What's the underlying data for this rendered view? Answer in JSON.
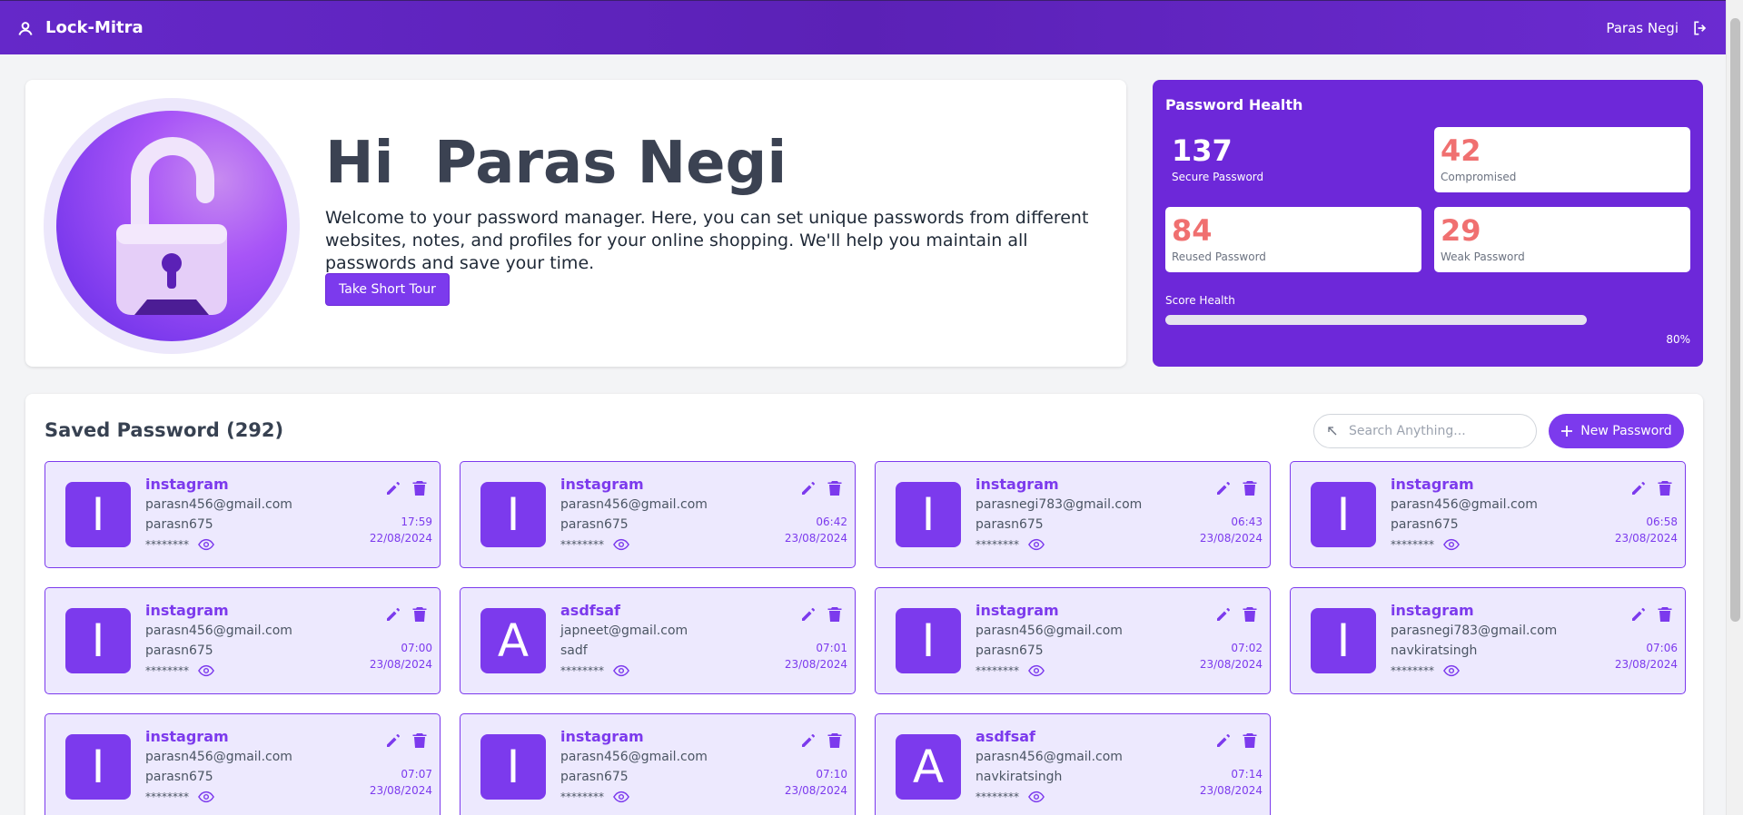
{
  "header": {
    "app_name": "Lock-Mitra",
    "user_name": "Paras Negi"
  },
  "welcome": {
    "greeting": "Hi  Paras Negi",
    "message": "Welcome to your password manager. Here, you can set unique passwords from different websites, notes, and profiles for your online shopping. We'll help you maintain all passwords and save your time.",
    "tour_button": "Take Short Tour"
  },
  "health": {
    "title": "Password Health",
    "secure": {
      "value": "137",
      "label": "Secure Password"
    },
    "compromised": {
      "value": "42",
      "label": "Compromised"
    },
    "reused": {
      "value": "84",
      "label": "Reused Password"
    },
    "weak": {
      "value": "29",
      "label": "Weak Password"
    },
    "score_label": "Score Health",
    "score_percent": "80%",
    "score_fraction": 0.8
  },
  "saved": {
    "title": "Saved Password (292)",
    "search_placeholder": "Search Anything...",
    "new_button": "New Password",
    "items": [
      {
        "letter": "I",
        "site": "instagram",
        "email": "parasn456@gmail.com",
        "username": "parasn675",
        "masked": "********",
        "time": "17:59",
        "date": "22/08/2024"
      },
      {
        "letter": "I",
        "site": "instagram",
        "email": "parasn456@gmail.com",
        "username": "parasn675",
        "masked": "********",
        "time": "06:42",
        "date": "23/08/2024"
      },
      {
        "letter": "I",
        "site": "instagram",
        "email": "parasnegi783@gmail.com",
        "username": "parasn675",
        "masked": "********",
        "time": "06:43",
        "date": "23/08/2024"
      },
      {
        "letter": "I",
        "site": "instagram",
        "email": "parasn456@gmail.com",
        "username": "parasn675",
        "masked": "********",
        "time": "06:58",
        "date": "23/08/2024"
      },
      {
        "letter": "I",
        "site": "instagram",
        "email": "parasn456@gmail.com",
        "username": "parasn675",
        "masked": "********",
        "time": "07:00",
        "date": "23/08/2024"
      },
      {
        "letter": "A",
        "site": "asdfsaf",
        "email": "japneet@gmail.com",
        "username": "sadf",
        "masked": "********",
        "time": "07:01",
        "date": "23/08/2024"
      },
      {
        "letter": "I",
        "site": "instagram",
        "email": "parasn456@gmail.com",
        "username": "parasn675",
        "masked": "********",
        "time": "07:02",
        "date": "23/08/2024"
      },
      {
        "letter": "I",
        "site": "instagram",
        "email": "parasnegi783@gmail.com",
        "username": "navkiratsingh",
        "masked": "********",
        "time": "07:06",
        "date": "23/08/2024"
      },
      {
        "letter": "I",
        "site": "instagram",
        "email": "parasn456@gmail.com",
        "username": "parasn675",
        "masked": "********",
        "time": "07:07",
        "date": "23/08/2024"
      },
      {
        "letter": "I",
        "site": "instagram",
        "email": "parasn456@gmail.com",
        "username": "parasn675",
        "masked": "********",
        "time": "07:10",
        "date": "23/08/2024"
      },
      {
        "letter": "A",
        "site": "asdfsaf",
        "email": "parasn456@gmail.com",
        "username": "navkiratsingh",
        "masked": "********",
        "time": "07:14",
        "date": "23/08/2024"
      }
    ]
  },
  "colors": {
    "primary": "#7c3aed",
    "header": "#5b21b6",
    "card_bg": "#ede9fe",
    "alert": "#f07070"
  }
}
